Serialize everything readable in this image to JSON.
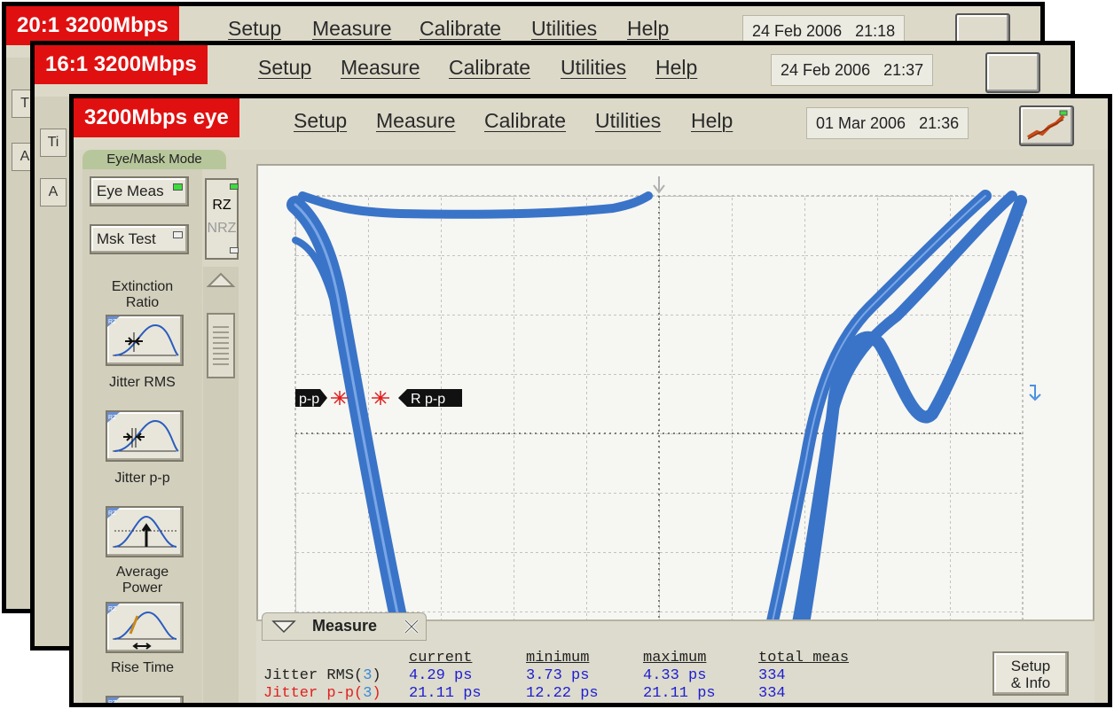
{
  "windows": [
    {
      "tag": "20:1 3200Mbps",
      "menu": [
        "Setup",
        "Measure",
        "Calibrate",
        "Utilities",
        "Help"
      ],
      "date": "24 Feb 2006   21:18"
    },
    {
      "tag": "16:1 3200Mbps",
      "menu": [
        "Setup",
        "Measure",
        "Calibrate",
        "Utilities",
        "Help"
      ],
      "date": "24 Feb 2006   21:37"
    },
    {
      "tag": "3200Mbps eye",
      "menu": [
        "Setup",
        "Measure",
        "Calibrate",
        "Utilities",
        "Help"
      ],
      "date": "01 Mar 2006   21:36"
    }
  ],
  "back_side_glyphs": [
    "T",
    "Ti",
    "A",
    "A"
  ],
  "mode_label": "Eye/Mask Mode",
  "sidebar": {
    "eye_meas": "Eye Meas",
    "msk_test": "Msk Test",
    "extinction_ratio_line1": "Extinction",
    "extinction_ratio_line2": "Ratio",
    "jitter_rms": "Jitter RMS",
    "jitter_pp": "Jitter p-p",
    "average_power_line1": "Average",
    "average_power_line2": "Power",
    "rise_time": "Rise Time",
    "icon_badge": "RZ"
  },
  "rz_label": "RZ",
  "nrz_label": "NRZ",
  "markers": {
    "left": "p-p",
    "right": "R p-p"
  },
  "measure": {
    "title": "Measure",
    "headers": [
      "current",
      "minimum",
      "maximum",
      "total meas"
    ],
    "rows": [
      {
        "label": "Jitter RMS(",
        "idx": "3",
        "close": ")",
        "current": "4.29 ps",
        "minimum": "3.73 ps",
        "maximum": "4.33 ps",
        "total": "334"
      },
      {
        "label": "Jitter p-p(",
        "idx": "3",
        "close": ")",
        "current": "21.11 ps",
        "minimum": "12.22 ps",
        "maximum": "21.11 ps",
        "total": "334"
      }
    ],
    "setup_line1": "Setup",
    "setup_line2": "& Info"
  },
  "colors": {
    "tag_red": "#e01010",
    "trace_blue": "#3a74c8",
    "grid": "#8e8e8e"
  }
}
